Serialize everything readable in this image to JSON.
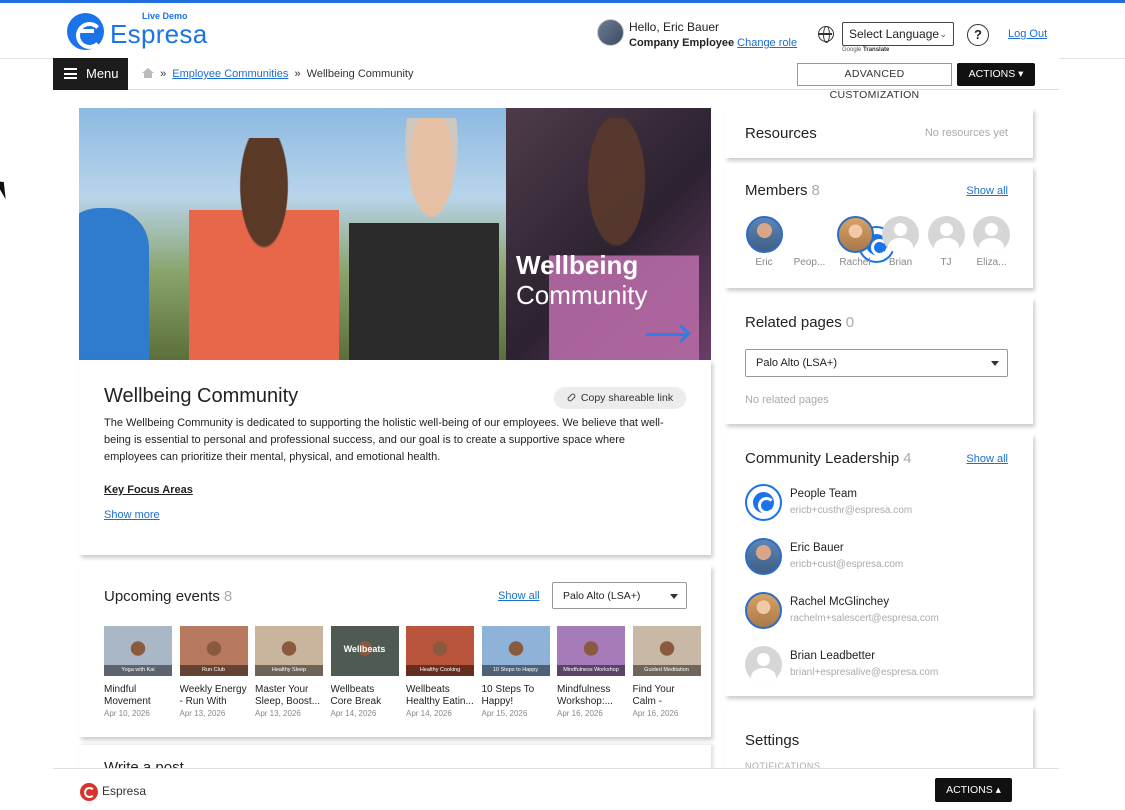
{
  "app": {
    "logo_text": "Espresa",
    "live_demo": "Live Demo"
  },
  "user": {
    "greeting": "Hello, Eric Bauer",
    "role": "Company Employee",
    "change_role": "Change role"
  },
  "header": {
    "language_select": "Select Language",
    "google_translate": "Translate",
    "google_label": "Google",
    "help": "?",
    "logout": "Log Out"
  },
  "nav": {
    "menu": "Menu",
    "breadcrumb": {
      "parent": "Employee Communities",
      "separator": "»",
      "current": "Wellbeing Community"
    },
    "advanced_customization": "ADVANCED CUSTOMIZATION",
    "actions": "ACTIONS"
  },
  "hero": {
    "title_line1": "Wellbeing",
    "title_line2": "Community"
  },
  "about": {
    "title": "Wellbeing Community",
    "share": "Copy shareable link",
    "description": "The Wellbeing Community is dedicated to supporting the holistic well-being of our employees. We believe that well-being is essential to personal and professional success, and our goal is to create a supportive space where employees can prioritize their mental, physical, and emotional health.",
    "key_focus": "Key Focus Areas",
    "show_more": "Show more"
  },
  "events": {
    "title": "Upcoming events",
    "count": "8",
    "show_all": "Show all",
    "location": "Palo Alto (LSA+)",
    "items": [
      {
        "name": "Mindful Movement Wi...",
        "date": "Apr 10, 2026",
        "tag": "Yoga with Kai",
        "big": "",
        "color": "#a9b7c6"
      },
      {
        "name": "Weekly Energy - Run With The...",
        "date": "Apr 13, 2026",
        "tag": "Run Club",
        "big": "",
        "color": "#b77a5f"
      },
      {
        "name": "Master Your Sleep, Boost...",
        "date": "Apr 13, 2026",
        "tag": "Healthy Sleep",
        "big": "",
        "color": "#c9b59e"
      },
      {
        "name": "Wellbeats Core Break",
        "date": "Apr 14, 2026",
        "tag": "",
        "big": "Wellbeats",
        "color": "#4e5a52"
      },
      {
        "name": "Wellbeats Healthy Eatin...",
        "date": "Apr 14, 2026",
        "tag": "Healthy Cooking",
        "big": "",
        "color": "#b9553d"
      },
      {
        "name": "10 Steps To Happy!",
        "date": "Apr 15, 2026",
        "tag": "10 Steps to Happy",
        "big": "",
        "color": "#8fb2d9"
      },
      {
        "name": "Mindfulness Workshop:...",
        "date": "Apr 16, 2026",
        "tag": "Mindfulness Workshop",
        "big": "",
        "color": "#a67bb9"
      },
      {
        "name": "Find Your Calm - Guided...",
        "date": "Apr 16, 2026",
        "tag": "Guided Meditation",
        "big": "",
        "color": "#c8b8a6"
      }
    ]
  },
  "write_post": {
    "title": "Write a post"
  },
  "resources": {
    "title": "Resources",
    "empty": "No resources yet"
  },
  "members": {
    "title": "Members",
    "count": "8",
    "show_all": "Show all",
    "items": [
      {
        "name": "Eric",
        "avatar": "photo-m"
      },
      {
        "name": "Peop...",
        "avatar": "logo"
      },
      {
        "name": "Rachel",
        "avatar": "photo-f"
      },
      {
        "name": "Brian",
        "avatar": "gray"
      },
      {
        "name": "TJ",
        "avatar": "gray"
      },
      {
        "name": "Eliza...",
        "avatar": "gray"
      }
    ]
  },
  "related": {
    "title": "Related pages",
    "count": "0",
    "location": "Palo Alto (LSA+)",
    "empty": "No related pages"
  },
  "leadership": {
    "title": "Community Leadership",
    "count": "4",
    "show_all": "Show all",
    "items": [
      {
        "name": "People Team",
        "email": "ericb+custhr@espresa.com",
        "avatar": "logo"
      },
      {
        "name": "Eric Bauer",
        "email": "ericb+cust@espresa.com",
        "avatar": "photo-m"
      },
      {
        "name": "Rachel McGlinchey",
        "email": "rachelm+salescert@espresa.com",
        "avatar": "photo-f"
      },
      {
        "name": "Brian Leadbetter",
        "email": "brianl+espresalive@espresa.com",
        "avatar": "gray"
      }
    ]
  },
  "settings": {
    "title": "Settings",
    "sub": "NOTIFICATIONS"
  },
  "footer": {
    "brand": "Espresa",
    "actions": "ACTIONS"
  },
  "colors": {
    "accent": "#1a73e8",
    "link": "#1a6fd1",
    "dark": "#111111"
  }
}
